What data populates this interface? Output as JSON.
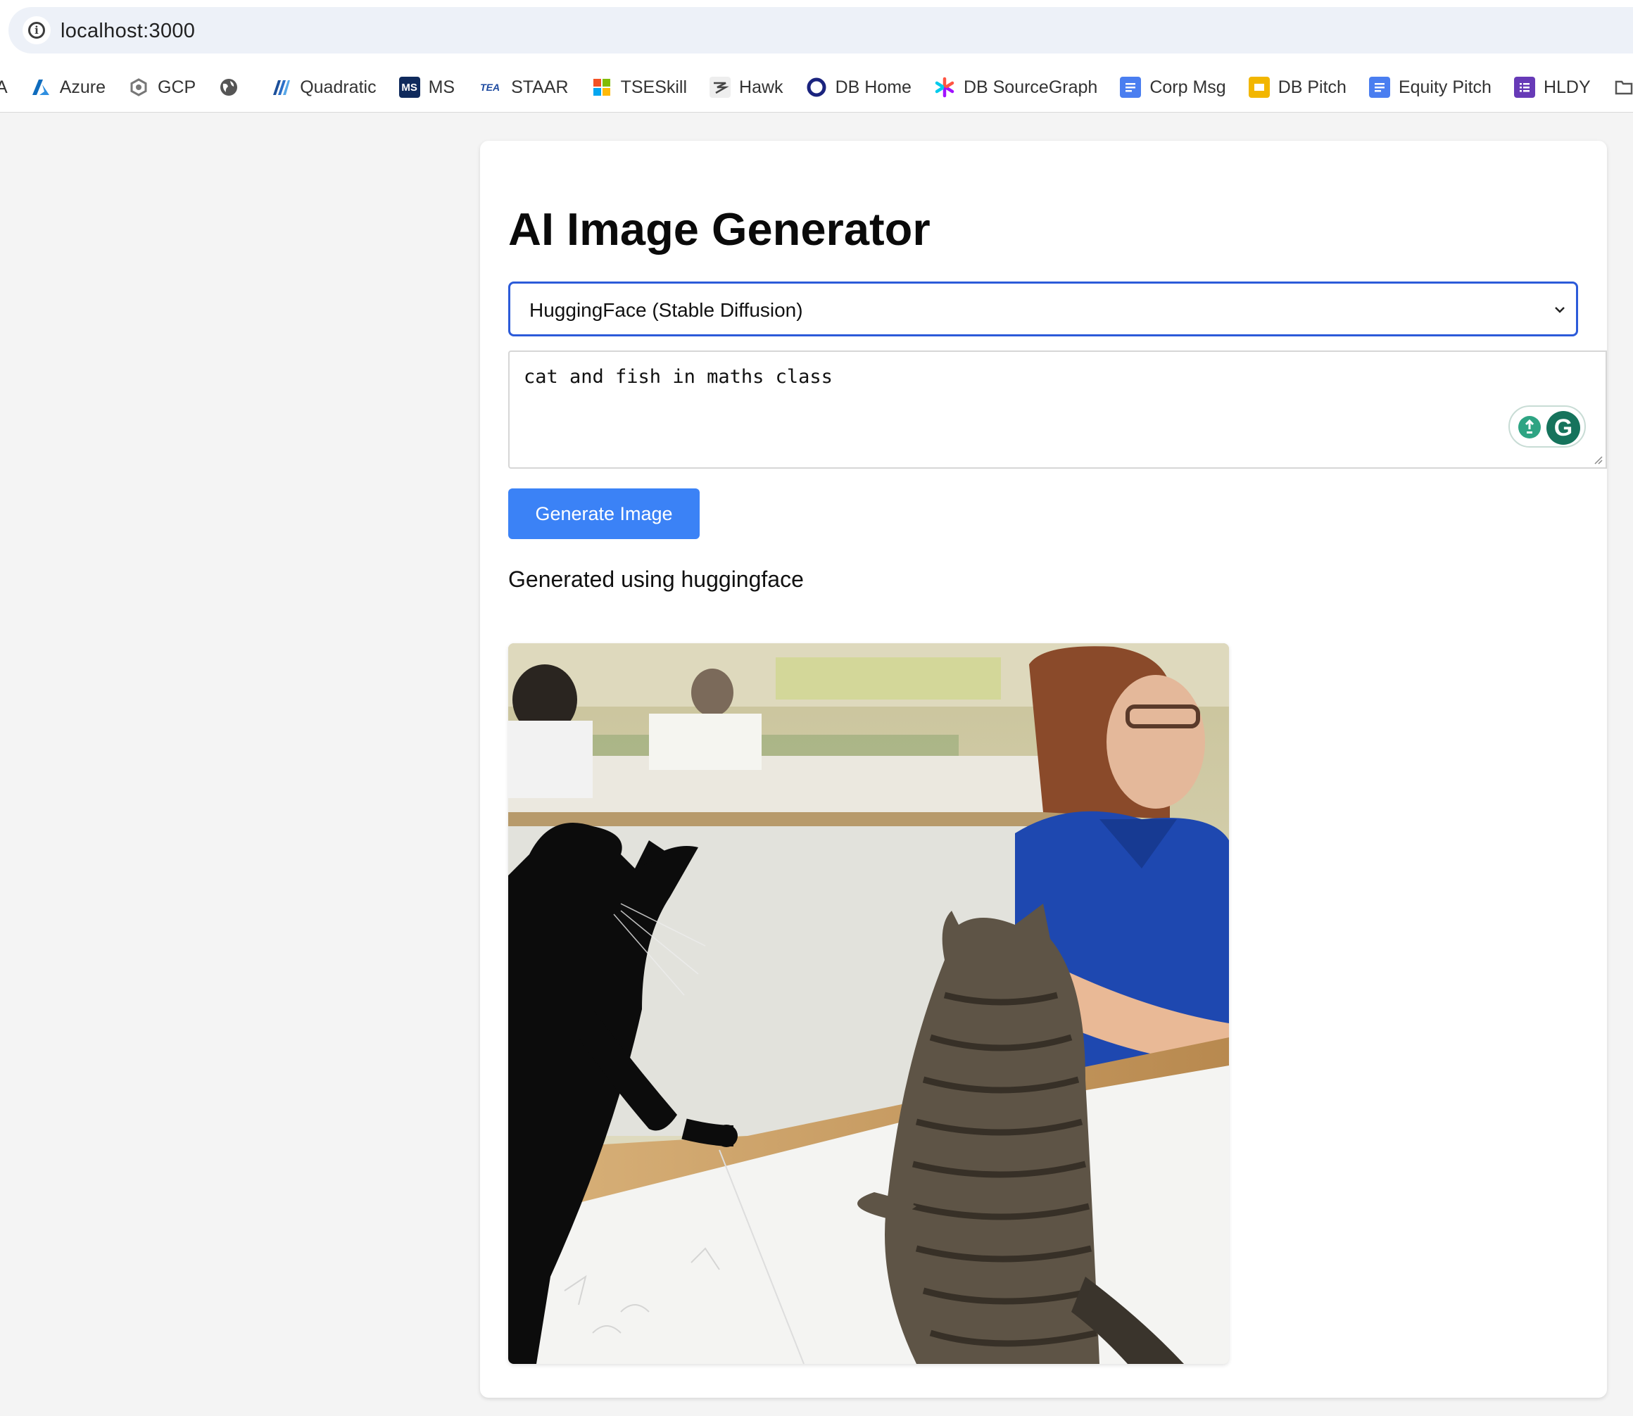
{
  "browser": {
    "url": "localhost:3000",
    "bookmarks": [
      {
        "label": "A",
        "icon": "none"
      },
      {
        "label": "Azure",
        "icon": "azure-icon",
        "color": "#0f6cbd"
      },
      {
        "label": "GCP",
        "icon": "gcp-icon",
        "color": "#6f6f6f"
      },
      {
        "label": "",
        "icon": "globe-icon",
        "color": "#555555"
      },
      {
        "label": "Quadratic",
        "icon": "quadratic-icon",
        "color": "#2b6fc7"
      },
      {
        "label": "MS",
        "icon": "ms-icon",
        "color": "#0f2a5c"
      },
      {
        "label": "STAAR",
        "icon": "tea-icon",
        "color": "#1d4aa0"
      },
      {
        "label": "TSESkill",
        "icon": "windows-icon",
        "color": "#f35325"
      },
      {
        "label": "Hawk",
        "icon": "hawk-icon",
        "color": "#555555"
      },
      {
        "label": "DB Home",
        "icon": "db-home-icon",
        "color": "#1a237e"
      },
      {
        "label": "DB SourceGraph",
        "icon": "sourcegraph-icon",
        "color": "#a112ff"
      },
      {
        "label": "Corp Msg",
        "icon": "docs-icon",
        "color": "#4a7ef0"
      },
      {
        "label": "DB Pitch",
        "icon": "slides-icon",
        "color": "#f2b600"
      },
      {
        "label": "Equity Pitch",
        "icon": "docs-icon",
        "color": "#4a7ef0"
      },
      {
        "label": "HLDY",
        "icon": "forms-icon",
        "color": "#673ab7"
      },
      {
        "label": "",
        "icon": "folder-icon",
        "color": "#555555"
      }
    ]
  },
  "app": {
    "title": "AI Image Generator",
    "provider_select": {
      "value": "HuggingFace (Stable Diffusion)"
    },
    "prompt": {
      "value": "cat and fish in maths class"
    },
    "generate_label": "Generate Image",
    "status": "Generated using huggingface"
  },
  "colors": {
    "accent": "#3b82f6",
    "focus": "#2c5bd9",
    "grammarly": "#16735c"
  }
}
